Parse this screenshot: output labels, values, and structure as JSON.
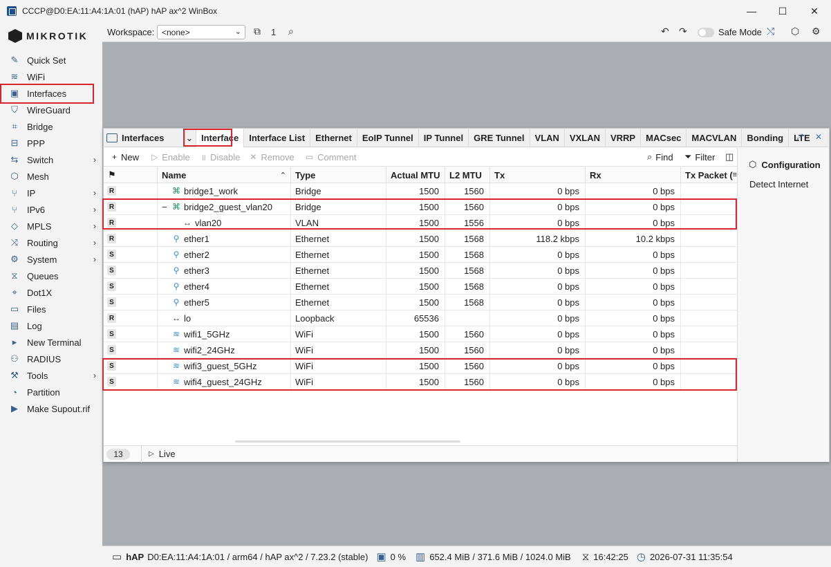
{
  "window": {
    "title": "CCCP@D0:EA:11:A4:1A:01 (hAP) hAP ax^2 WinBox",
    "minimize": "—",
    "maximize": "☐",
    "close": "✕"
  },
  "brand": {
    "logo_text": "MIKROTIK"
  },
  "sidebar": {
    "items": [
      {
        "label": "Quick Set",
        "icon": "wand-icon",
        "glyph": "✎",
        "arrow": ""
      },
      {
        "label": "WiFi",
        "icon": "wifi-icon",
        "glyph": "≋",
        "arrow": ""
      },
      {
        "label": "Interfaces",
        "icon": "interfaces-icon",
        "glyph": "▣",
        "arrow": ""
      },
      {
        "label": "WireGuard",
        "icon": "wireguard-icon",
        "glyph": "⛉",
        "arrow": ""
      },
      {
        "label": "Bridge",
        "icon": "bridge-icon",
        "glyph": "⌗",
        "arrow": ""
      },
      {
        "label": "PPP",
        "icon": "ppp-icon",
        "glyph": "⊟",
        "arrow": ""
      },
      {
        "label": "Switch",
        "icon": "switch-icon",
        "glyph": "⇆",
        "arrow": "›"
      },
      {
        "label": "Mesh",
        "icon": "mesh-icon",
        "glyph": "⬡",
        "arrow": ""
      },
      {
        "label": "IP",
        "icon": "ip-icon",
        "glyph": "⑂",
        "arrow": "›"
      },
      {
        "label": "IPv6",
        "icon": "ipv6-icon",
        "glyph": "⑂",
        "arrow": "›"
      },
      {
        "label": "MPLS",
        "icon": "mpls-icon",
        "glyph": "◇",
        "arrow": "›"
      },
      {
        "label": "Routing",
        "icon": "routing-icon",
        "glyph": "⤨",
        "arrow": "›"
      },
      {
        "label": "System",
        "icon": "system-icon",
        "glyph": "⚙",
        "arrow": "›"
      },
      {
        "label": "Queues",
        "icon": "queues-icon",
        "glyph": "⧖",
        "arrow": ""
      },
      {
        "label": "Dot1X",
        "icon": "dot1x-icon",
        "glyph": "⌖",
        "arrow": ""
      },
      {
        "label": "Files",
        "icon": "files-icon",
        "glyph": "▭",
        "arrow": ""
      },
      {
        "label": "Log",
        "icon": "log-icon",
        "glyph": "▤",
        "arrow": ""
      },
      {
        "label": "New Terminal",
        "icon": "terminal-icon",
        "glyph": "▸",
        "arrow": ""
      },
      {
        "label": "RADIUS",
        "icon": "radius-icon",
        "glyph": "⚇",
        "arrow": ""
      },
      {
        "label": "Tools",
        "icon": "tools-icon",
        "glyph": "⚒",
        "arrow": "›"
      },
      {
        "label": "Partition",
        "icon": "partition-icon",
        "glyph": "◔",
        "arrow": ""
      },
      {
        "label": "Make Supout.rif",
        "icon": "supout-icon",
        "glyph": "▶",
        "arrow": ""
      }
    ]
  },
  "toolbar": {
    "workspace_label": "Workspace:",
    "workspace_value": "<none>",
    "windows_count": "1",
    "safe_mode_label": "Safe Mode"
  },
  "interfaces_window": {
    "title": "Interfaces",
    "tabs": [
      "Interface",
      "Interface List",
      "Ethernet",
      "EoIP Tunnel",
      "IP Tunnel",
      "GRE Tunnel",
      "VLAN",
      "VXLAN",
      "VRRP",
      "MACsec",
      "MACVLAN",
      "Bonding",
      "LTE"
    ],
    "actions": {
      "new": "New",
      "enable": "Enable",
      "disable": "Disable",
      "remove": "Remove",
      "comment": "Comment",
      "find": "Find",
      "filter": "Filter"
    },
    "columns": [
      "",
      "Name",
      "Type",
      "Actual MTU",
      "L2 MTU",
      "Tx",
      "Rx",
      "Tx Packet ("
    ],
    "rows": [
      {
        "flag": "R",
        "name": "bridge1_work",
        "icon": "bridge",
        "indent": 0,
        "expander": "",
        "type": "Bridge",
        "mtu": "1500",
        "l2mtu": "1560",
        "tx": "0 bps",
        "rx": "0 bps"
      },
      {
        "flag": "R",
        "name": "bridge2_guest_vlan20",
        "icon": "bridge",
        "indent": 0,
        "expander": "−",
        "type": "Bridge",
        "mtu": "1500",
        "l2mtu": "1560",
        "tx": "0 bps",
        "rx": "0 bps"
      },
      {
        "flag": "R",
        "name": "vlan20",
        "icon": "vlan",
        "indent": 1,
        "expander": "",
        "type": "VLAN",
        "mtu": "1500",
        "l2mtu": "1556",
        "tx": "0 bps",
        "rx": "0 bps"
      },
      {
        "flag": "R",
        "name": "ether1",
        "icon": "ether",
        "indent": 0,
        "expander": "",
        "type": "Ethernet",
        "mtu": "1500",
        "l2mtu": "1568",
        "tx": "118.2 kbps",
        "rx": "10.2 kbps"
      },
      {
        "flag": "S",
        "name": "ether2",
        "icon": "ether",
        "indent": 0,
        "expander": "",
        "type": "Ethernet",
        "mtu": "1500",
        "l2mtu": "1568",
        "tx": "0 bps",
        "rx": "0 bps"
      },
      {
        "flag": "S",
        "name": "ether3",
        "icon": "ether",
        "indent": 0,
        "expander": "",
        "type": "Ethernet",
        "mtu": "1500",
        "l2mtu": "1568",
        "tx": "0 bps",
        "rx": "0 bps"
      },
      {
        "flag": "S",
        "name": "ether4",
        "icon": "ether",
        "indent": 0,
        "expander": "",
        "type": "Ethernet",
        "mtu": "1500",
        "l2mtu": "1568",
        "tx": "0 bps",
        "rx": "0 bps"
      },
      {
        "flag": "S",
        "name": "ether5",
        "icon": "ether",
        "indent": 0,
        "expander": "",
        "type": "Ethernet",
        "mtu": "1500",
        "l2mtu": "1568",
        "tx": "0 bps",
        "rx": "0 bps"
      },
      {
        "flag": "R",
        "name": "lo",
        "icon": "lo",
        "indent": 0,
        "expander": "",
        "type": "Loopback",
        "mtu": "65536",
        "l2mtu": "",
        "tx": "0 bps",
        "rx": "0 bps"
      },
      {
        "flag": "S",
        "name": "wifi1_5GHz",
        "icon": "wifi",
        "indent": 0,
        "expander": "",
        "type": "WiFi",
        "mtu": "1500",
        "l2mtu": "1560",
        "tx": "0 bps",
        "rx": "0 bps"
      },
      {
        "flag": "S",
        "name": "wifi2_24GHz",
        "icon": "wifi",
        "indent": 0,
        "expander": "",
        "type": "WiFi",
        "mtu": "1500",
        "l2mtu": "1560",
        "tx": "0 bps",
        "rx": "0 bps"
      },
      {
        "flag": "S",
        "name": "wifi3_guest_5GHz",
        "icon": "wifi",
        "indent": 0,
        "expander": "",
        "type": "WiFi",
        "mtu": "1500",
        "l2mtu": "1560",
        "tx": "0 bps",
        "rx": "0 bps"
      },
      {
        "flag": "S",
        "name": "wifi4_guest_24GHz",
        "icon": "wifi",
        "indent": 0,
        "expander": "",
        "type": "WiFi",
        "mtu": "1500",
        "l2mtu": "1560",
        "tx": "0 bps",
        "rx": "0 bps"
      }
    ],
    "row_count": "13",
    "live_label": "Live",
    "side_panel": {
      "title": "Configuration",
      "items": [
        "Detect Internet"
      ]
    }
  },
  "statusbar": {
    "device": "hAP",
    "info": "D0:EA:11:A4:1A:01 / arm64 / hAP ax^2 / 7.23.2 (stable)",
    "cpu": "0 %",
    "memory": "652.4 MiB / 371.6 MiB / 1024.0 MiB",
    "uptime": "16:42:25",
    "datetime": "2026-07-31 11:35:54"
  },
  "colors": {
    "highlight": "#d9262e",
    "workspace_bg": "#aaaeb3",
    "accent": "#3a5f8a"
  }
}
